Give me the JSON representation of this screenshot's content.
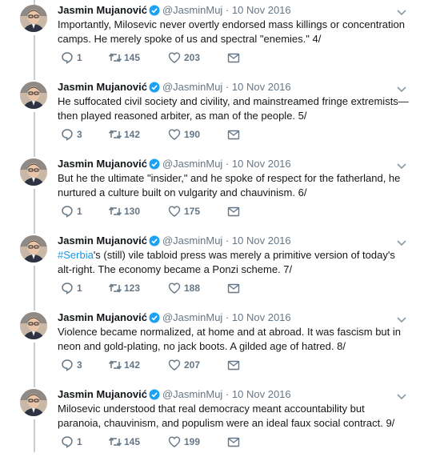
{
  "colors": {
    "link": "#1b95e0",
    "secondary_text": "#657786",
    "primary_text": "#14171a",
    "verified_badge": "#1da1f2",
    "thread_line": "#c4cfd6"
  },
  "icons": {
    "reply": "reply-icon",
    "retweet": "retweet-icon",
    "like": "heart-icon",
    "message": "envelope-icon",
    "more": "chevron-down-icon",
    "verified": "verified-badge-icon"
  },
  "tweets": [
    {
      "author": "Jasmin Mujanović",
      "handle": "@JasminMuj",
      "separator": "·",
      "date": "10 Nov 2016",
      "hashtag": "",
      "text": "Importantly, Milosevic never overtly endorsed mass killings or concentration camps. He merely spoke of us and spectral \"enemies.\" 4/",
      "replies": "1",
      "retweets": "145",
      "likes": "203"
    },
    {
      "author": "Jasmin Mujanović",
      "handle": "@JasminMuj",
      "separator": "·",
      "date": "10 Nov 2016",
      "hashtag": "",
      "text": "He suffocated civil society and civility, and mainstreamed fringe extremists—then played reasoned arbiter, as man of the people. 5/",
      "replies": "3",
      "retweets": "142",
      "likes": "190"
    },
    {
      "author": "Jasmin Mujanović",
      "handle": "@JasminMuj",
      "separator": "·",
      "date": "10 Nov 2016",
      "hashtag": "",
      "text": "But he the ultimate \"insider,\" and he spoke of respect for the fatherland, he nurtured a culture built on vulgarity and chauvinism. 6/",
      "replies": "1",
      "retweets": "130",
      "likes": "175"
    },
    {
      "author": "Jasmin Mujanović",
      "handle": "@JasminMuj",
      "separator": "·",
      "date": "10 Nov 2016",
      "hashtag": "#Serbia",
      "text": "'s (still) vile tabloid press was merely a primitive version of today's alt-right. The economy became a Ponzi scheme. 7/",
      "replies": "1",
      "retweets": "123",
      "likes": "188"
    },
    {
      "author": "Jasmin Mujanović",
      "handle": "@JasminMuj",
      "separator": "·",
      "date": "10 Nov 2016",
      "hashtag": "",
      "text": "Violence became normalized, at home and at abroad. It was fascism but in neon and gold-plating, no jack boots. A gilded age of hatred. 8/",
      "replies": "3",
      "retweets": "142",
      "likes": "207"
    },
    {
      "author": "Jasmin Mujanović",
      "handle": "@JasminMuj",
      "separator": "·",
      "date": "10 Nov 2016",
      "hashtag": "",
      "text": "Milosevic understood that real democracy meant accountability but paranoia, chauvinism, and populism were an ideal faux social contract. 9/",
      "replies": "1",
      "retweets": "145",
      "likes": "199"
    }
  ]
}
